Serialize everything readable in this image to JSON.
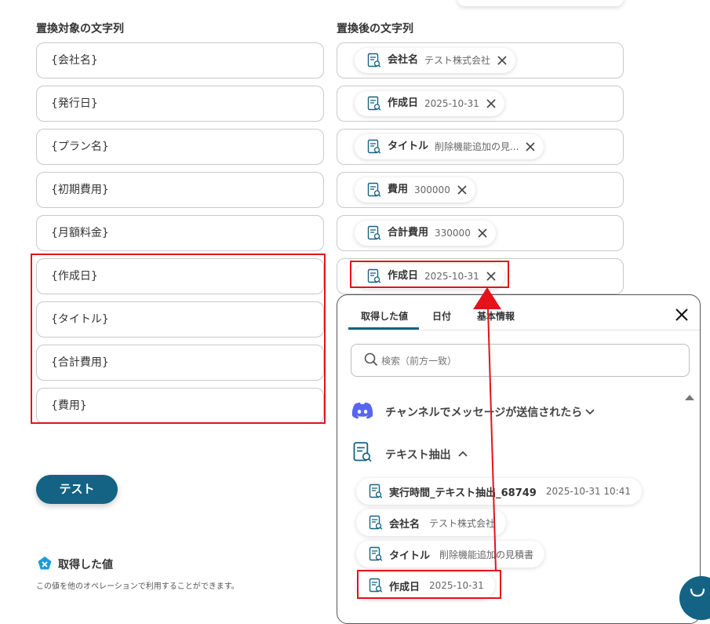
{
  "left": {
    "header": "置換対象の文字列",
    "fields": [
      "{会社名}",
      "{発行日}",
      "{プラン名}",
      "{初期費用}",
      "{月額料金}",
      "{作成日}",
      "{タイトル}",
      "{合計費用}",
      "{費用}"
    ]
  },
  "right": {
    "header": "置換後の文字列",
    "chips": [
      {
        "name": "会社名",
        "value": "テスト株式会社"
      },
      {
        "name": "作成日",
        "value": "2025-10-31"
      },
      {
        "name": "タイトル",
        "value": "削除機能追加の見..."
      },
      {
        "name": "費用",
        "value": "300000"
      },
      {
        "name": "合計費用",
        "value": "330000"
      },
      {
        "name": "作成日",
        "value": "2025-10-31"
      }
    ]
  },
  "test_button": "テスト",
  "fetched": {
    "title": "取得した値",
    "description": "この値を他のオペレーションで利用することができます。"
  },
  "panel": {
    "tabs": [
      "取得した値",
      "日付",
      "基本情報"
    ],
    "search_placeholder": "検索（前方一致）",
    "sections": [
      {
        "label": "チャンネルでメッセージが送信されたら"
      },
      {
        "label": "テキスト抽出"
      }
    ],
    "items": [
      {
        "name": "実行時間_テキスト抽出_68749",
        "value": "2025-10-31 10:41"
      },
      {
        "name": "会社名",
        "value": "テスト株式会社"
      },
      {
        "name": "タイトル",
        "value": "削除機能追加の見積書"
      },
      {
        "name": "作成日",
        "value": "2025-10-31"
      }
    ]
  },
  "colors": {
    "accent": "#146384",
    "highlight": "#e3121b",
    "discord": "#5865f2",
    "tab_underline": "#146384"
  },
  "icons": [
    "text-extract-icon",
    "close-icon",
    "search-icon",
    "discord-icon",
    "chevron-down-icon",
    "chevron-up-icon",
    "scroll-up-icon",
    "yoom-logo-icon",
    "chat-icon"
  ]
}
